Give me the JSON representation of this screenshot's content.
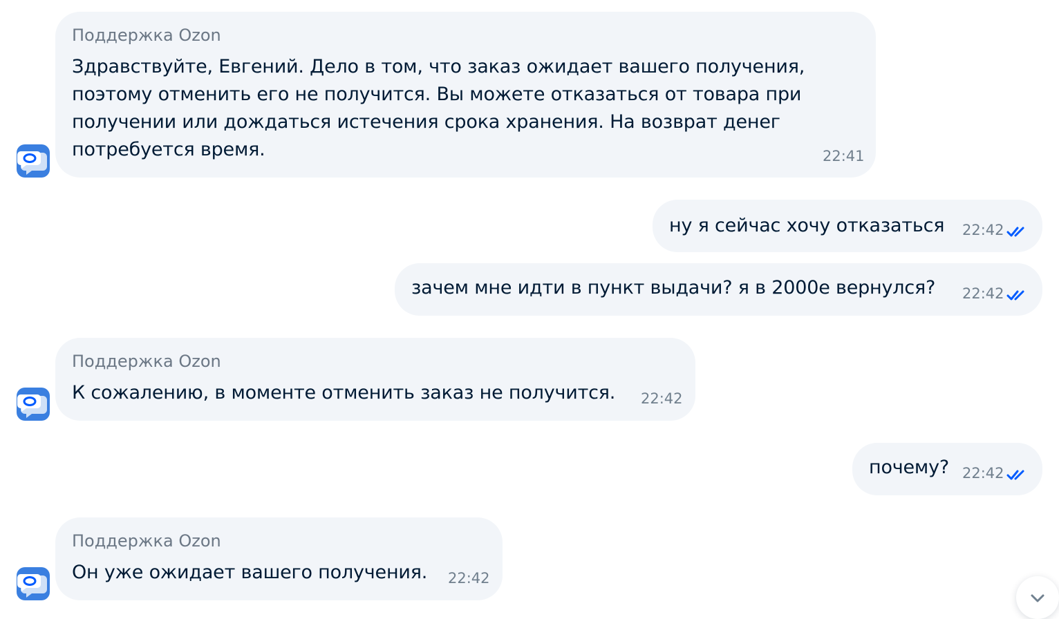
{
  "chat": {
    "messages": [
      {
        "sender": "Поддержка Ozon",
        "lines": [
          "Здравствуйте, Евгений. Дело в том, что заказ ожидает вашего получения,",
          "поэтому отменить его не получится. Вы можете отказаться от товара при",
          "получении или дождаться истечения срока хранения. На возврат денег",
          "потребуется время."
        ],
        "time": "22:41",
        "direction": "incoming"
      },
      {
        "text": "ну я сейчас хочу отказаться",
        "time": "22:42",
        "direction": "outgoing",
        "status": "read"
      },
      {
        "text": "зачем мне идти в пункт выдачи? я в 2000е вернулся?",
        "time": "22:42",
        "direction": "outgoing",
        "status": "read"
      },
      {
        "sender": "Поддержка Ozon",
        "text": "К сожалению, в моменте отменить заказ не получится.",
        "time": "22:42",
        "direction": "incoming"
      },
      {
        "text": "почему?",
        "time": "22:42",
        "direction": "outgoing",
        "status": "read"
      },
      {
        "sender": "Поддержка Ozon",
        "text": "Он уже ожидает вашего получения.",
        "time": "22:42",
        "direction": "incoming"
      }
    ],
    "icons": {
      "avatar": "ozon-support-chat-icon",
      "read_receipt": "double-check-icon",
      "scroll_down": "chevron-down-icon"
    },
    "colors": {
      "bubble": "#f2f5f9",
      "text": "#001a34",
      "muted": "#707f8d",
      "accent": "#005bff",
      "avatar_bg": "#3a7fe0"
    }
  }
}
